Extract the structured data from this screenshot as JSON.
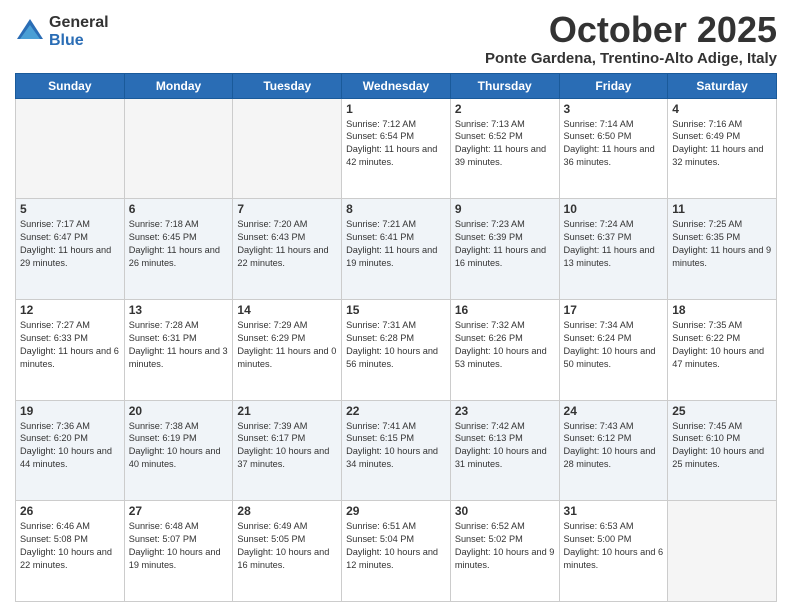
{
  "logo": {
    "general": "General",
    "blue": "Blue"
  },
  "header": {
    "month": "October 2025",
    "location": "Ponte Gardena, Trentino-Alto Adige, Italy"
  },
  "days_of_week": [
    "Sunday",
    "Monday",
    "Tuesday",
    "Wednesday",
    "Thursday",
    "Friday",
    "Saturday"
  ],
  "weeks": [
    [
      {
        "day": "",
        "info": ""
      },
      {
        "day": "",
        "info": ""
      },
      {
        "day": "",
        "info": ""
      },
      {
        "day": "1",
        "info": "Sunrise: 7:12 AM\nSunset: 6:54 PM\nDaylight: 11 hours and 42 minutes."
      },
      {
        "day": "2",
        "info": "Sunrise: 7:13 AM\nSunset: 6:52 PM\nDaylight: 11 hours and 39 minutes."
      },
      {
        "day": "3",
        "info": "Sunrise: 7:14 AM\nSunset: 6:50 PM\nDaylight: 11 hours and 36 minutes."
      },
      {
        "day": "4",
        "info": "Sunrise: 7:16 AM\nSunset: 6:49 PM\nDaylight: 11 hours and 32 minutes."
      }
    ],
    [
      {
        "day": "5",
        "info": "Sunrise: 7:17 AM\nSunset: 6:47 PM\nDaylight: 11 hours and 29 minutes."
      },
      {
        "day": "6",
        "info": "Sunrise: 7:18 AM\nSunset: 6:45 PM\nDaylight: 11 hours and 26 minutes."
      },
      {
        "day": "7",
        "info": "Sunrise: 7:20 AM\nSunset: 6:43 PM\nDaylight: 11 hours and 22 minutes."
      },
      {
        "day": "8",
        "info": "Sunrise: 7:21 AM\nSunset: 6:41 PM\nDaylight: 11 hours and 19 minutes."
      },
      {
        "day": "9",
        "info": "Sunrise: 7:23 AM\nSunset: 6:39 PM\nDaylight: 11 hours and 16 minutes."
      },
      {
        "day": "10",
        "info": "Sunrise: 7:24 AM\nSunset: 6:37 PM\nDaylight: 11 hours and 13 minutes."
      },
      {
        "day": "11",
        "info": "Sunrise: 7:25 AM\nSunset: 6:35 PM\nDaylight: 11 hours and 9 minutes."
      }
    ],
    [
      {
        "day": "12",
        "info": "Sunrise: 7:27 AM\nSunset: 6:33 PM\nDaylight: 11 hours and 6 minutes."
      },
      {
        "day": "13",
        "info": "Sunrise: 7:28 AM\nSunset: 6:31 PM\nDaylight: 11 hours and 3 minutes."
      },
      {
        "day": "14",
        "info": "Sunrise: 7:29 AM\nSunset: 6:29 PM\nDaylight: 11 hours and 0 minutes."
      },
      {
        "day": "15",
        "info": "Sunrise: 7:31 AM\nSunset: 6:28 PM\nDaylight: 10 hours and 56 minutes."
      },
      {
        "day": "16",
        "info": "Sunrise: 7:32 AM\nSunset: 6:26 PM\nDaylight: 10 hours and 53 minutes."
      },
      {
        "day": "17",
        "info": "Sunrise: 7:34 AM\nSunset: 6:24 PM\nDaylight: 10 hours and 50 minutes."
      },
      {
        "day": "18",
        "info": "Sunrise: 7:35 AM\nSunset: 6:22 PM\nDaylight: 10 hours and 47 minutes."
      }
    ],
    [
      {
        "day": "19",
        "info": "Sunrise: 7:36 AM\nSunset: 6:20 PM\nDaylight: 10 hours and 44 minutes."
      },
      {
        "day": "20",
        "info": "Sunrise: 7:38 AM\nSunset: 6:19 PM\nDaylight: 10 hours and 40 minutes."
      },
      {
        "day": "21",
        "info": "Sunrise: 7:39 AM\nSunset: 6:17 PM\nDaylight: 10 hours and 37 minutes."
      },
      {
        "day": "22",
        "info": "Sunrise: 7:41 AM\nSunset: 6:15 PM\nDaylight: 10 hours and 34 minutes."
      },
      {
        "day": "23",
        "info": "Sunrise: 7:42 AM\nSunset: 6:13 PM\nDaylight: 10 hours and 31 minutes."
      },
      {
        "day": "24",
        "info": "Sunrise: 7:43 AM\nSunset: 6:12 PM\nDaylight: 10 hours and 28 minutes."
      },
      {
        "day": "25",
        "info": "Sunrise: 7:45 AM\nSunset: 6:10 PM\nDaylight: 10 hours and 25 minutes."
      }
    ],
    [
      {
        "day": "26",
        "info": "Sunrise: 6:46 AM\nSunset: 5:08 PM\nDaylight: 10 hours and 22 minutes."
      },
      {
        "day": "27",
        "info": "Sunrise: 6:48 AM\nSunset: 5:07 PM\nDaylight: 10 hours and 19 minutes."
      },
      {
        "day": "28",
        "info": "Sunrise: 6:49 AM\nSunset: 5:05 PM\nDaylight: 10 hours and 16 minutes."
      },
      {
        "day": "29",
        "info": "Sunrise: 6:51 AM\nSunset: 5:04 PM\nDaylight: 10 hours and 12 minutes."
      },
      {
        "day": "30",
        "info": "Sunrise: 6:52 AM\nSunset: 5:02 PM\nDaylight: 10 hours and 9 minutes."
      },
      {
        "day": "31",
        "info": "Sunrise: 6:53 AM\nSunset: 5:00 PM\nDaylight: 10 hours and 6 minutes."
      },
      {
        "day": "",
        "info": ""
      }
    ]
  ]
}
